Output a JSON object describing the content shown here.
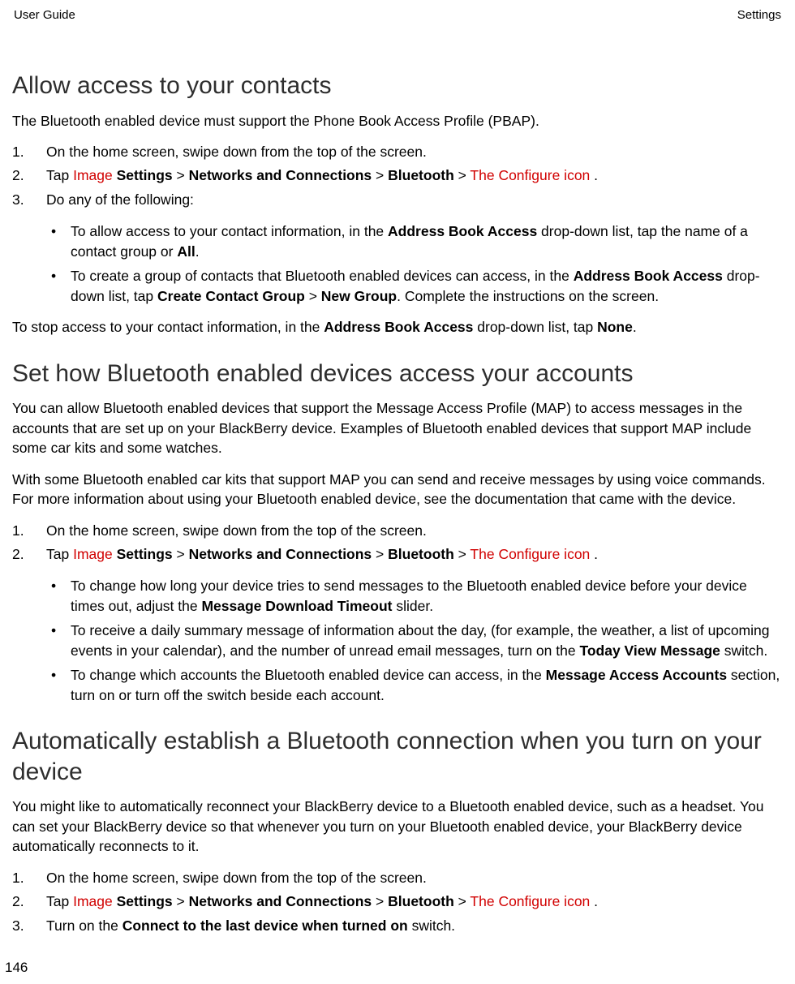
{
  "header": {
    "left": "User Guide",
    "right": "Settings"
  },
  "page_number": "146",
  "section1": {
    "title": "Allow access to your contacts",
    "intro": "The Bluetooth enabled device must support the Phone Book Access Profile (PBAP).",
    "step1": "On the home screen, swipe down from the top of the screen.",
    "step2_tap": "Tap ",
    "step2_image": "Image",
    "step2_settings": " Settings",
    "step2_gt1": " > ",
    "step2_networks": "Networks and Connections",
    "step2_gt2": " > ",
    "step2_bluetooth": "Bluetooth",
    "step2_gt3": " > ",
    "step2_configure": " The Configure icon ",
    "step2_period": ".",
    "step3": "Do any of the following:",
    "bullet1_a": "To allow access to your contact information, in the ",
    "bullet1_b": "Address Book Access",
    "bullet1_c": " drop-down list, tap the name of a contact group or ",
    "bullet1_d": "All",
    "bullet1_e": ".",
    "bullet2_a": "To create a group of contacts that Bluetooth enabled devices can access, in the ",
    "bullet2_b": "Address Book Access",
    "bullet2_c": " drop-down list, tap ",
    "bullet2_d": "Create Contact Group",
    "bullet2_e": " > ",
    "bullet2_f": "New Group",
    "bullet2_g": ". Complete the instructions on the screen.",
    "outro_a": "To stop access to your contact information, in the ",
    "outro_b": "Address Book Access",
    "outro_c": " drop-down list, tap ",
    "outro_d": "None",
    "outro_e": "."
  },
  "section2": {
    "title": "Set how Bluetooth enabled devices access your accounts",
    "para1": "You can allow Bluetooth enabled devices that support the Message Access Profile (MAP) to access messages in the accounts that are set up on your BlackBerry device. Examples of Bluetooth enabled devices that support MAP include some car kits and some watches.",
    "para2": "With some Bluetooth enabled car kits that support MAP you can send and receive messages by using voice commands. For more information about using your Bluetooth enabled device, see the documentation that came with the device.",
    "step1": "On the home screen, swipe down from the top of the screen.",
    "step2_tap": "Tap ",
    "step2_image": "Image",
    "step2_settings": " Settings",
    "step2_gt1": " > ",
    "step2_networks": "Networks and Connections",
    "step2_gt2": " > ",
    "step2_bluetooth": "Bluetooth",
    "step2_gt3": " > ",
    "step2_configure": " The Configure icon ",
    "step2_period": ".",
    "bullet1_a": "To change how long your device tries to send messages to the Bluetooth enabled device before your device times out, adjust the ",
    "bullet1_b": "Message Download Timeout",
    "bullet1_c": " slider.",
    "bullet2_a": "To receive a daily summary message of information about the day, (for example, the weather, a list of upcoming events in your calendar), and the number of unread email messages, turn on the ",
    "bullet2_b": "Today View Message",
    "bullet2_c": " switch.",
    "bullet3_a": "To change which accounts the Bluetooth enabled device can access, in the ",
    "bullet3_b": "Message Access Accounts",
    "bullet3_c": " section, turn on or turn off the switch beside each account."
  },
  "section3": {
    "title": "Automatically establish a Bluetooth connection when you turn on your device",
    "para1": "You might like to automatically reconnect your BlackBerry device to a Bluetooth enabled device, such as a headset. You can set your BlackBerry device so that whenever you turn on your Bluetooth enabled device, your BlackBerry device automatically reconnects to it.",
    "step1": "On the home screen, swipe down from the top of the screen.",
    "step2_tap": "Tap ",
    "step2_image": "Image",
    "step2_settings": " Settings",
    "step2_gt1": " > ",
    "step2_networks": "Networks and Connections",
    "step2_gt2": " > ",
    "step2_bluetooth": "Bluetooth",
    "step2_gt3": " > ",
    "step2_configure": " The Configure icon ",
    "step2_period": ".",
    "step3_a": "Turn on the ",
    "step3_b": "Connect to the last device when turned on",
    "step3_c": " switch."
  }
}
